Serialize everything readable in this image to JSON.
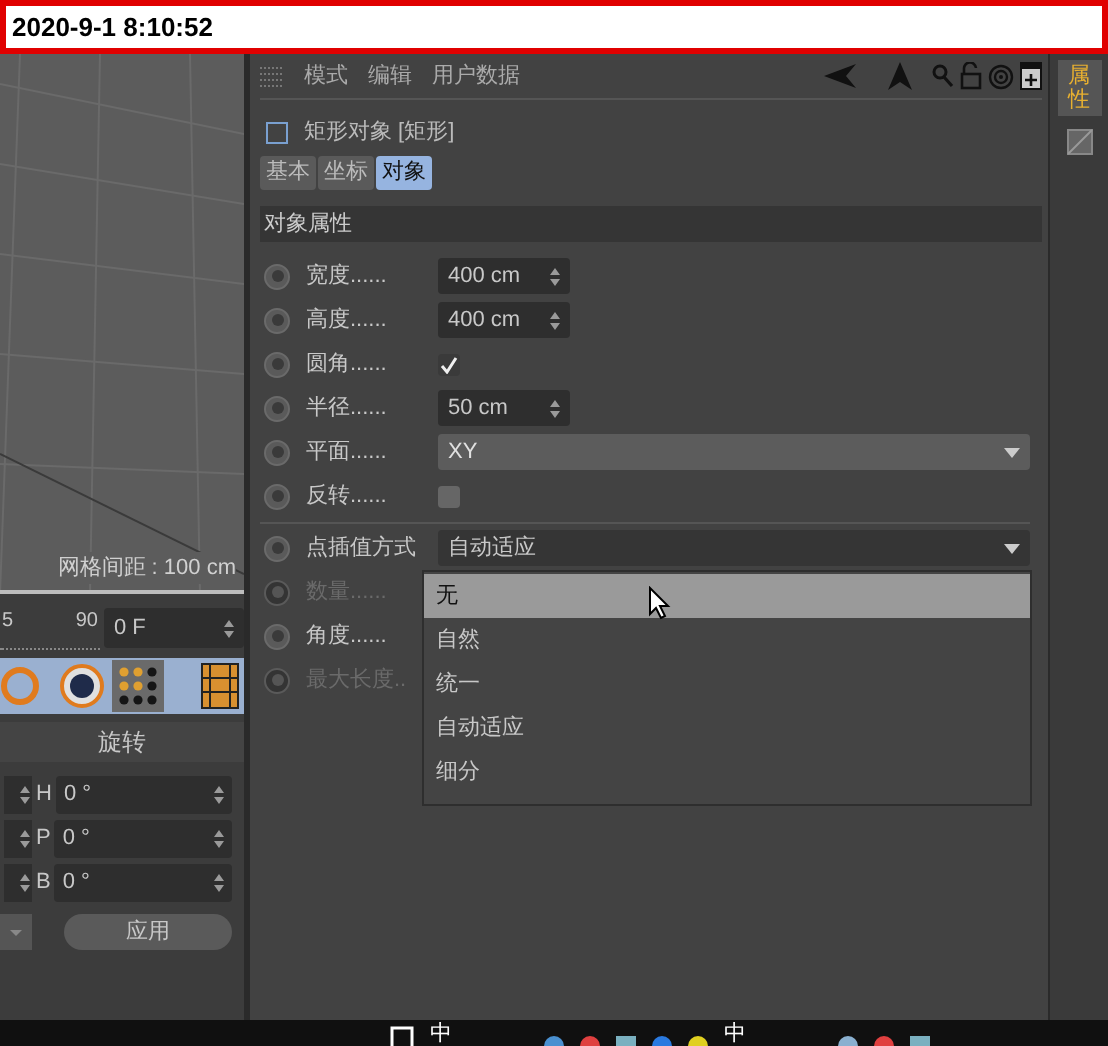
{
  "timestamp": "2020-9-1 8:10:52",
  "viewport": {
    "grid_label": "网格间距 : 100 cm"
  },
  "timeline": {
    "ticks": [
      "5",
      "90"
    ],
    "frame": "0 F"
  },
  "rotation": {
    "title": "旋转",
    "rows": [
      {
        "axis": "H",
        "value": "0 °"
      },
      {
        "axis": "P",
        "value": "0 °"
      },
      {
        "axis": "B",
        "value": "0 °"
      }
    ],
    "apply": "应用"
  },
  "attributes": {
    "menu": [
      "模式",
      "编辑",
      "用户数据"
    ],
    "object_title": "矩形对象 [矩形]",
    "object_checked": false,
    "tabs": [
      {
        "label": "基本",
        "selected": false
      },
      {
        "label": "坐标",
        "selected": false
      },
      {
        "label": "对象",
        "selected": true
      }
    ],
    "section": "对象属性",
    "properties": [
      {
        "kind": "field",
        "label": "宽度......",
        "value": "400 cm"
      },
      {
        "kind": "field",
        "label": "高度......",
        "value": "400 cm"
      },
      {
        "kind": "check",
        "label": "圆角......",
        "checked": true
      },
      {
        "kind": "field",
        "label": "半径......",
        "value": "50 cm"
      },
      {
        "kind": "select",
        "label": "平面......",
        "value": "XY"
      },
      {
        "kind": "check",
        "label": "反转......",
        "checked": false
      }
    ],
    "interpolation": {
      "label": "点插值方式",
      "value": "自动适应",
      "options": [
        {
          "label": "无",
          "highlighted": true
        },
        {
          "label": "自然",
          "highlighted": false
        },
        {
          "label": "统一",
          "highlighted": false
        },
        {
          "label": "自动适应",
          "highlighted": false
        },
        {
          "label": "细分",
          "highlighted": false
        }
      ]
    },
    "lower_properties": [
      {
        "label": "数量......",
        "disabled": true
      },
      {
        "label": "角度......",
        "disabled": false
      },
      {
        "label": "最大长度..",
        "disabled": true
      }
    ]
  },
  "side_tabs": [
    {
      "label": "属性",
      "selected": true
    }
  ],
  "taskbar": {
    "texts": [
      "中",
      "中"
    ]
  }
}
